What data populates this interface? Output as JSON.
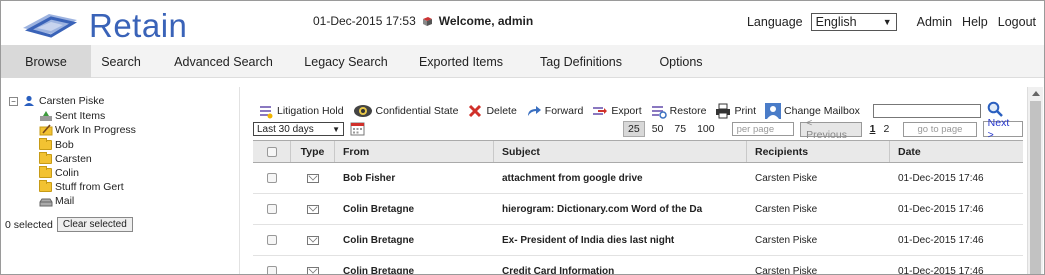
{
  "header": {
    "logo_text": "Retain",
    "datetime": "01-Dec-2015 17:53",
    "welcome": "Welcome, admin",
    "language_label": "Language",
    "language_value": "English",
    "links": [
      "Admin",
      "Help",
      "Logout"
    ]
  },
  "nav": {
    "tabs": [
      "Browse",
      "Search",
      "Advanced Search",
      "Legacy Search",
      "Exported Items",
      "Tag Definitions",
      "Options"
    ],
    "active": "Browse"
  },
  "sidebar": {
    "root": "Carsten Piske",
    "items": [
      "Sent Items",
      "Work In Progress",
      "Bob",
      "Carsten",
      "Colin",
      "Stuff from Gert",
      "Mail"
    ],
    "selected_text": "0 selected",
    "clear_button": "Clear selected"
  },
  "toolbar": {
    "litigation_hold": "Litigation Hold",
    "confidential_state": "Confidential State",
    "delete": "Delete",
    "forward": "Forward",
    "export": "Export",
    "restore": "Restore",
    "print": "Print",
    "change_mailbox": "Change Mailbox",
    "search_value": ""
  },
  "filter": {
    "range": "Last 30 days"
  },
  "pager": {
    "sizes": [
      "25",
      "50",
      "75",
      "100"
    ],
    "active_size": "25",
    "per_page_placeholder": "per page",
    "previous": "< Previous",
    "pages": [
      "1",
      "2"
    ],
    "current_page": "1",
    "goto_placeholder": "go to page",
    "next": "Next >"
  },
  "table": {
    "headers": [
      "Type",
      "From",
      "Subject",
      "Recipients",
      "Date"
    ],
    "rows": [
      {
        "from": "Bob Fisher",
        "subject": "attachment from google drive",
        "recipients": "Carsten Piske",
        "date": "01-Dec-2015 17:46"
      },
      {
        "from": "Colin Bretagne",
        "subject": "hierogram: Dictionary.com Word of the Da",
        "recipients": "Carsten Piske",
        "date": "01-Dec-2015 17:46"
      },
      {
        "from": "Colin Bretagne",
        "subject": "Ex- President of India dies last night",
        "recipients": "Carsten Piske",
        "date": "01-Dec-2015 17:46"
      },
      {
        "from": "Colin Bretagne",
        "subject": "Credit Card Information",
        "recipients": "Carsten Piske",
        "date": "01-Dec-2015 17:46"
      }
    ]
  },
  "colors": {
    "brand": "#3a63b8",
    "nav_bg": "#f3f3f3",
    "nav_active": "#d9d9d9",
    "table_header": "#e9e9e9"
  }
}
